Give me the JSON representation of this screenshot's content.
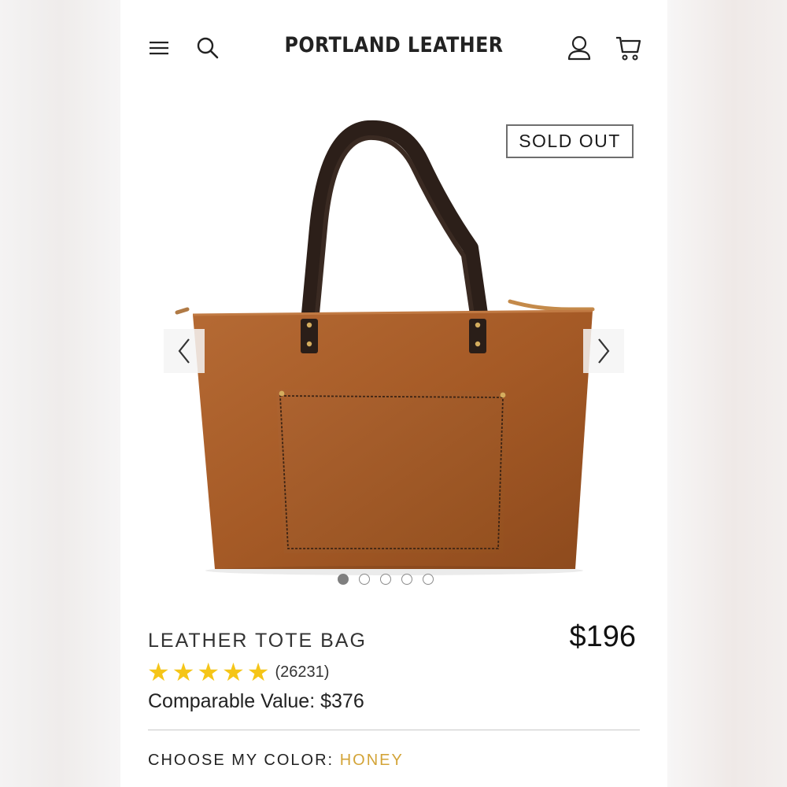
{
  "header": {
    "brand": "PORTLAND LEATHER",
    "menu_icon": "menu-icon",
    "search_icon": "search-icon",
    "account_icon": "user-icon",
    "cart_icon": "cart-icon"
  },
  "gallery": {
    "badge": "SOLD OUT",
    "image_count": 5,
    "active_index": 0,
    "prev_icon": "chevron-left-icon",
    "next_icon": "chevron-right-icon"
  },
  "product": {
    "title": "LEATHER TOTE BAG",
    "price": "$196",
    "rating_stars": 5,
    "review_count": "(26231)",
    "comparable_value": "Comparable Value: $376",
    "color_label": "CHOOSE MY COLOR:",
    "color_value": "HONEY"
  },
  "colors": {
    "star": "#f5c518",
    "color_value_accent": "#d3a438",
    "leather": "#a85d2a"
  }
}
